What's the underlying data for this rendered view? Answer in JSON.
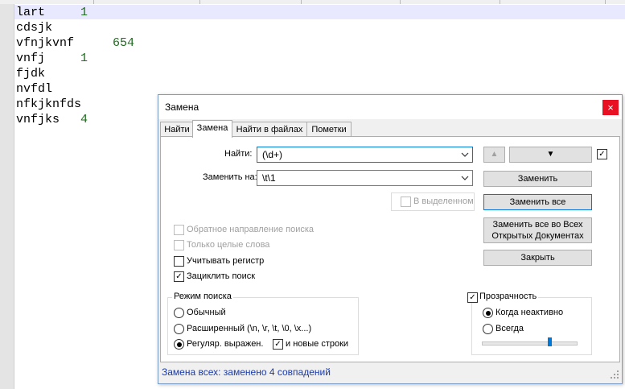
{
  "editor": {
    "lines": [
      {
        "word": "lart",
        "num": "1"
      },
      {
        "word": "cdsjk",
        "num": ""
      },
      {
        "word": "vfnjkvnf",
        "num": "654"
      },
      {
        "word": "vnfj",
        "num": "1"
      },
      {
        "word": "fjdk",
        "num": ""
      },
      {
        "word": "nvfdl",
        "num": ""
      },
      {
        "word": "nfkjknfds",
        "num": ""
      },
      {
        "word": "vnfjks",
        "num": "4"
      }
    ]
  },
  "dialog": {
    "title": "Замена",
    "close_glyph": "×",
    "tabs": [
      "Найти",
      "Замена",
      "Найти в файлах",
      "Пометки"
    ],
    "find_label": "Найти:",
    "find_value": "(\\d+)",
    "replace_label": "Заменить на:",
    "replace_value": "\\t\\1",
    "in_selection": "В выделенном",
    "backward_search": "Обратное направление поиска",
    "whole_word": "Только целые слова",
    "match_case": "Учитывать регистр",
    "wrap_around": "Зациклить поиск",
    "search_mode": {
      "title": "Режим поиска",
      "normal": "Обычный",
      "extended": "Расширенный (\\n, \\r, \\t, \\0, \\x...)",
      "regex": "Регуляр. выражен.",
      "newline": "и новые строки"
    },
    "buttons": {
      "prev_glyph": "▲",
      "next_glyph": "▼",
      "replace": "Заменить",
      "replace_all": "Заменить все",
      "replace_all_open_line1": "Заменить все во Всех",
      "replace_all_open_line2": "Открытых Документах",
      "close": "Закрыть"
    },
    "transparency": {
      "title": "Прозрачность",
      "on_lose_focus": "Когда неактивно",
      "always": "Всегда",
      "level": 0.72
    },
    "status": "Замена всех: заменено 4 совпадений",
    "check_glyph": "✓"
  }
}
